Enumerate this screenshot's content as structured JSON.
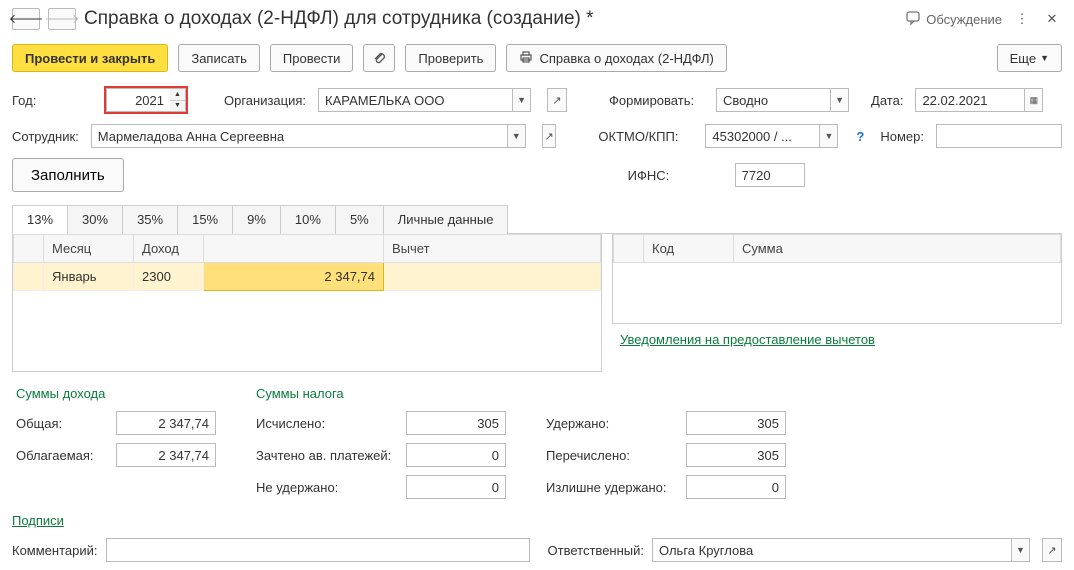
{
  "header": {
    "title": "Справка о доходах (2-НДФЛ) для сотрудника (создание) *",
    "discuss": "Обсуждение"
  },
  "toolbar": {
    "post_close": "Провести и закрыть",
    "save": "Записать",
    "post": "Провести",
    "check": "Проверить",
    "cert": "Справка о доходах (2-НДФЛ)",
    "more": "Еще"
  },
  "form": {
    "year_label": "Год:",
    "year_value": "2021",
    "org_label": "Организация:",
    "org_value": "КАРАМЕЛЬКА ООО",
    "form_label": "Формировать:",
    "form_value": "Сводно",
    "date_label": "Дата:",
    "date_value": "22.02.2021",
    "emp_label": "Сотрудник:",
    "emp_value": "Мармеладова Анна Сергеевна",
    "oktmo_label": "ОКТМО/КПП:",
    "oktmo_value": "45302000 / ...",
    "number_label": "Номер:",
    "number_value": "",
    "fill": "Заполнить",
    "ifns_label": "ИФНС:",
    "ifns_value": "7720"
  },
  "tabs": [
    "13%",
    "30%",
    "35%",
    "15%",
    "9%",
    "10%",
    "5%",
    "Личные данные"
  ],
  "left_grid": {
    "cols": [
      "",
      "Месяц",
      "Доход",
      "",
      "Вычет"
    ],
    "row": {
      "month": "Январь",
      "code": "2300",
      "amount": "2 347,74",
      "deduct": ""
    }
  },
  "right_grid": {
    "cols": [
      "",
      "Код",
      "Сумма"
    ]
  },
  "notif_link": "Уведомления на предоставление вычетов",
  "totals": {
    "income_title": "Суммы дохода",
    "tax_title": "Суммы налога",
    "total_label": "Общая:",
    "total_value": "2 347,74",
    "taxable_label": "Облагаемая:",
    "taxable_value": "2 347,74",
    "calc_label": "Исчислено:",
    "calc_value": "305",
    "adv_label": "Зачтено ав. платежей:",
    "adv_value": "0",
    "notheld_label": "Не удержано:",
    "notheld_value": "0",
    "held_label": "Удержано:",
    "held_value": "305",
    "trans_label": "Перечислено:",
    "trans_value": "305",
    "over_label": "Излишне удержано:",
    "over_value": "0"
  },
  "signatures_link": "Подписи",
  "bottom": {
    "comment_label": "Комментарий:",
    "comment_value": "",
    "resp_label": "Ответственный:",
    "resp_value": "Ольга Круглова"
  }
}
